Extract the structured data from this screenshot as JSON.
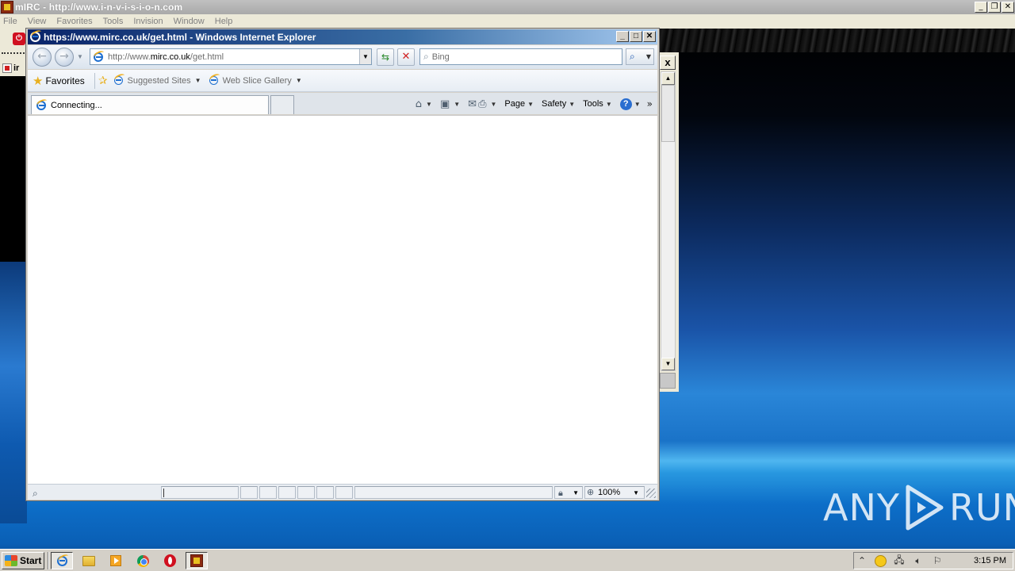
{
  "mirc": {
    "title": "mIRC - http://www.i-n-v-i-s-i-o-n.com",
    "menu": [
      "File",
      "View",
      "Favorites",
      "Tools",
      "Invision",
      "Window",
      "Help"
    ],
    "tab_fragment": "ir",
    "child_close": "x"
  },
  "ie": {
    "title": "https://www.mirc.co.uk/get.html - Windows Internet Explorer",
    "address": {
      "prefix": "http://www.",
      "domain": "mirc.co.uk",
      "path": "/get.html"
    },
    "search_placeholder": "Bing",
    "favorites_label": "Favorites",
    "links": [
      {
        "label": "Suggested Sites"
      },
      {
        "label": "Web Slice Gallery"
      }
    ],
    "tab_label": "Connecting...",
    "commands": {
      "page": "Page",
      "safety": "Safety",
      "tools": "Tools"
    },
    "zoom": "100%"
  },
  "taskbar": {
    "start_label": "Start",
    "clock": "3:15 PM"
  },
  "watermark": {
    "left": "ANY",
    "right": "RUN"
  },
  "icons": {
    "ie": "internet-explorer-icon",
    "back": "back-arrow-icon",
    "forward": "forward-arrow-icon",
    "refresh": "refresh-icon",
    "stop": "stop-icon",
    "search": "magnifier-icon",
    "favorites": "star-icon",
    "home": "home-icon",
    "feeds": "rss-icon",
    "mail": "mail-icon",
    "print": "printer-icon",
    "help": "help-icon"
  }
}
